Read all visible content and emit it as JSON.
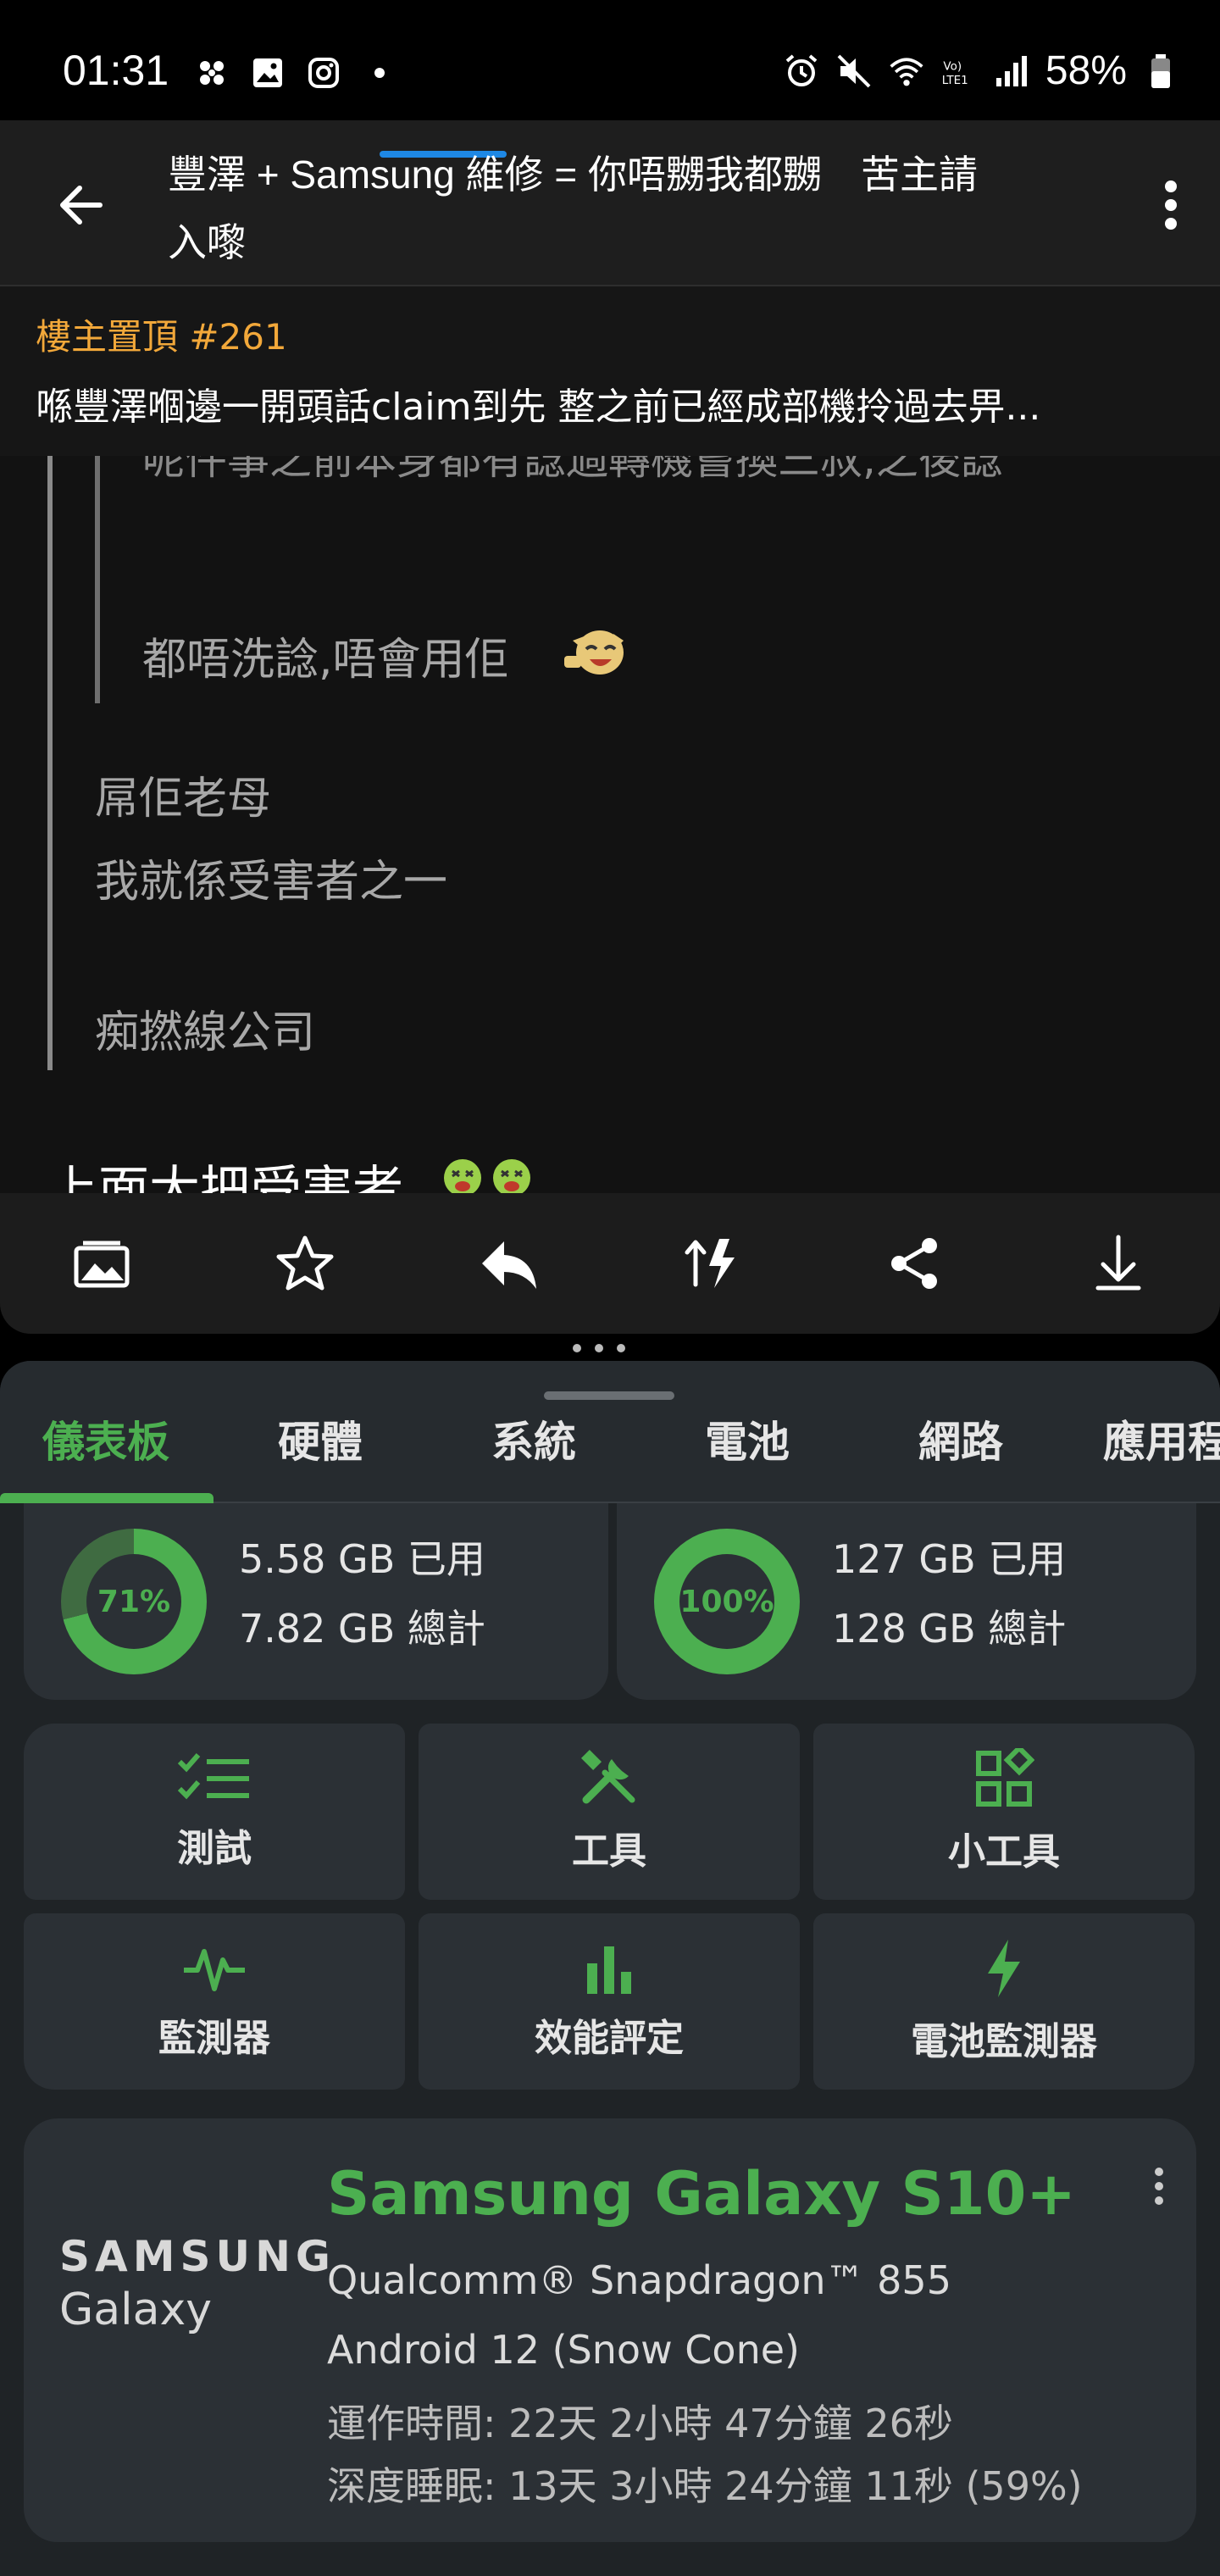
{
  "status_bar": {
    "time": "01:31",
    "battery_percent": "58%",
    "left_icons": [
      "pinwheel-icon",
      "gallery-icon",
      "instagram-icon",
      "dot-icon"
    ],
    "right_icons": [
      "alarm-icon",
      "mute-icon",
      "wifi-icon",
      "volte-icon",
      "signal-icon",
      "battery-icon"
    ]
  },
  "thread": {
    "title": "豐澤 + Samsung 維修 = 你唔嬲我都嬲　苦主請入嚟",
    "pinned_label": "樓主置頂 #261",
    "pinned_text": "喺豐澤嗰邊一開頭話claim到先 整之前已經成部機拎過去畀...",
    "quote_cut_line": "呢件事之前本身都有諗過轉機嘗換三叔,之後諗",
    "quote_line2": "都唔洗諗,唔會用佢",
    "quote_text1": "屌佢老母",
    "quote_text2": "我就係受害者之一",
    "quote_text3": "痴撚線公司",
    "reply_text": "上面大把受害者"
  },
  "bottom_actions": [
    "image-icon",
    "star-icon",
    "reply-icon",
    "sort-icon",
    "share-icon",
    "download-icon"
  ],
  "device_info_app": {
    "tabs": [
      "儀表板",
      "硬體",
      "系統",
      "電池",
      "網路",
      "應用程"
    ],
    "active_tab": 0,
    "ram": {
      "percent": 71,
      "percent_label": "71%",
      "used": "5.58 GB 已用",
      "total": "7.82 GB 總計"
    },
    "storage": {
      "percent": 100,
      "percent_label": "100%",
      "used": "127 GB 已用",
      "total": "128 GB 總計"
    },
    "tiles": [
      {
        "label": "測試",
        "icon": "checklist-icon"
      },
      {
        "label": "工具",
        "icon": "tools-icon"
      },
      {
        "label": "小工具",
        "icon": "widgets-icon"
      },
      {
        "label": "監測器",
        "icon": "pulse-icon"
      },
      {
        "label": "效能評定",
        "icon": "bar-chart-icon"
      },
      {
        "label": "電池監測器",
        "icon": "lightning-icon"
      }
    ],
    "device": {
      "brand_line1": "SAMSUNG",
      "brand_line2": "Galaxy",
      "name": "Samsung Galaxy S10+",
      "chip": "Qualcomm® Snapdragon™ 855",
      "os": "Android 12 (Snow Cone)",
      "uptime": "運作時間: 22天 2小時 47分鐘 26秒",
      "deep_sleep": "深度睡眠: 13天 3小時 24分鐘 11秒 (59%)"
    },
    "accent_color": "#4caf50"
  }
}
